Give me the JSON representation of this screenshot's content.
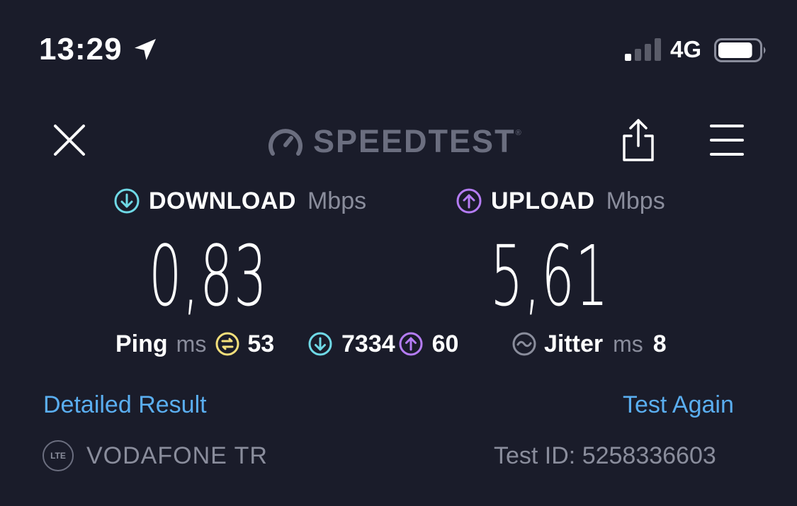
{
  "status_bar": {
    "time": "13:29",
    "location_icon": "location-arrow-icon",
    "network": "4G",
    "signal_bars_active": 1,
    "signal_bars_total": 4,
    "battery_level": 0.85
  },
  "header": {
    "close_icon": "close-icon",
    "logo_text": "SPEEDTEST",
    "share_icon": "share-icon",
    "menu_icon": "menu-icon"
  },
  "download": {
    "label": "DOWNLOAD",
    "unit": "Mbps",
    "value": "0,83",
    "icon": "download-arrow-icon",
    "color": "#6fd9e6"
  },
  "upload": {
    "label": "UPLOAD",
    "unit": "Mbps",
    "value": "5,61",
    "icon": "upload-arrow-icon",
    "color": "#b57cf5"
  },
  "ping": {
    "label": "Ping",
    "unit": "ms",
    "idle_value": "53",
    "download_value": "7334",
    "upload_value": "60",
    "idle_color": "#f3df7b"
  },
  "jitter": {
    "label": "Jitter",
    "unit": "ms",
    "value": "8"
  },
  "links": {
    "detailed": "Detailed Result",
    "again": "Test Again"
  },
  "footer": {
    "badge": "LTE",
    "provider": "VODAFONE TR",
    "test_id": "Test ID: 5258336603"
  },
  "colors": {
    "background": "#1a1c2a",
    "link": "#5aaef0",
    "muted": "#8a8d9c"
  }
}
